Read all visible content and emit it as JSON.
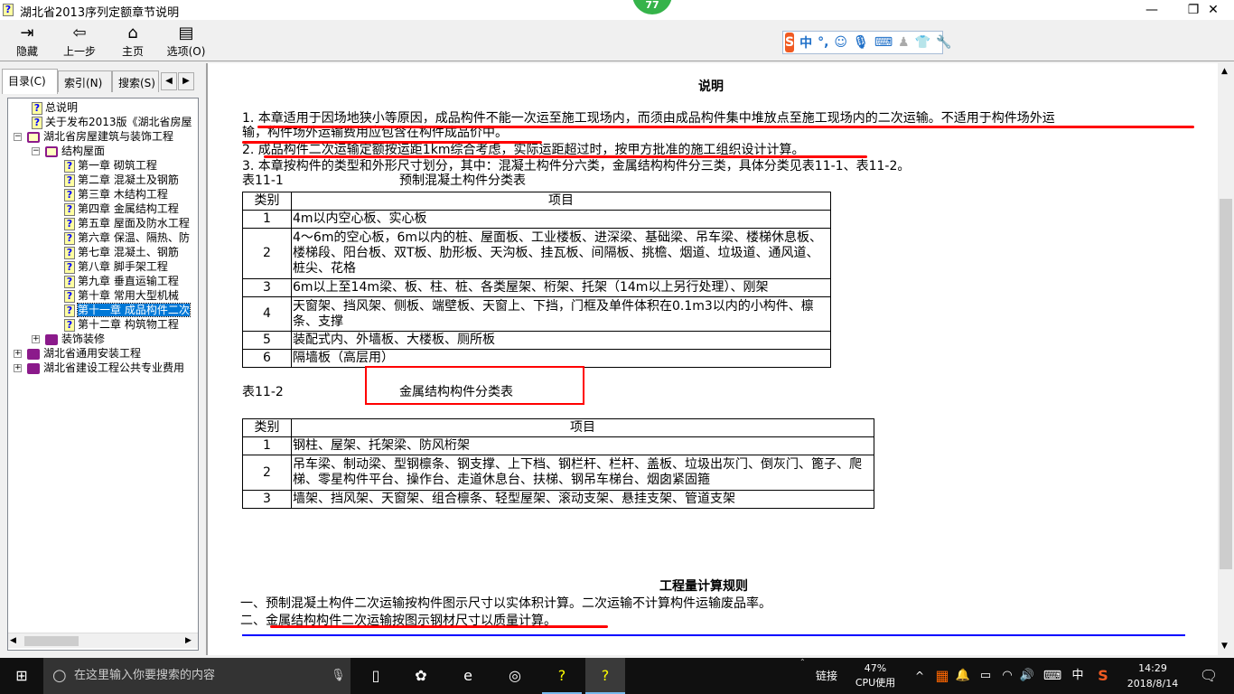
{
  "window": {
    "title": "湖北省2013序列定额章节说明",
    "badge": "77"
  },
  "toolbar": {
    "hide": "隐藏",
    "back": "上一步",
    "home": "主页",
    "options": "选项(O)"
  },
  "ime": {
    "lang": "中",
    "punct": "°,"
  },
  "tabs": {
    "contents": "目录(C)",
    "index": "索引(N)",
    "search": "搜索(S)"
  },
  "tree": [
    {
      "label": "总说明",
      "level": 2,
      "icon": "help-page"
    },
    {
      "label": "关于发布2013版《湖北省房屋",
      "level": 2,
      "icon": "help-page"
    },
    {
      "label": "湖北省房屋建筑与装饰工程",
      "level": 1,
      "icon": "open-book",
      "toggle": "−"
    },
    {
      "label": "结构屋面",
      "level": 2,
      "icon": "open-book",
      "toggle": "−"
    },
    {
      "label": "第一章  砌筑工程",
      "level": 3,
      "icon": "help-page"
    },
    {
      "label": "第二章  混凝土及钢筋",
      "level": 3,
      "icon": "help-page"
    },
    {
      "label": "第三章  木结构工程",
      "level": 3,
      "icon": "help-page"
    },
    {
      "label": "第四章  金属结构工程",
      "level": 3,
      "icon": "help-page"
    },
    {
      "label": "第五章  屋面及防水工程",
      "level": 3,
      "icon": "help-page"
    },
    {
      "label": "第六章  保温、隔热、防",
      "level": 3,
      "icon": "help-page"
    },
    {
      "label": "第七章  混凝土、钢筋",
      "level": 3,
      "icon": "help-page"
    },
    {
      "label": "第八章  脚手架工程",
      "level": 3,
      "icon": "help-page"
    },
    {
      "label": "第九章  垂直运输工程",
      "level": 3,
      "icon": "help-page"
    },
    {
      "label": "第十章  常用大型机械",
      "level": 3,
      "icon": "help-page"
    },
    {
      "label": "第十一章  成品构件二次",
      "level": 3,
      "icon": "help-page",
      "selected": true
    },
    {
      "label": "第十二章  构筑物工程",
      "level": 3,
      "icon": "help-page"
    },
    {
      "label": "装饰装修",
      "level": 2,
      "icon": "closed-book",
      "toggle": "+"
    },
    {
      "label": "湖北省通用安装工程",
      "level": 1,
      "icon": "closed-book",
      "toggle": "+"
    },
    {
      "label": "湖北省建设工程公共专业费用",
      "level": 1,
      "icon": "closed-book",
      "toggle": "+"
    }
  ],
  "doc": {
    "title": "说明",
    "p1a": "1. 本章适用于因场地狭小等原因，成品构件不能一次运至施工现场内，而须由成品构件集中堆放点至施工现场内的二次运输。不适用于构件场外运",
    "p1b": "输，构件场外运输费用应包含在构件成品价中。",
    "p2": "2. 成品构件二次运输定额按运距1km综合考虑，实际运距超过时，按甲方批准的施工组织设计计算。",
    "p3": "3. 本章按构件的类型和外形尺寸划分，其中：混凝土构件分六类，金属结构构件分三类，具体分类见表11-1、表11-2。",
    "t1_label": "表11-1",
    "t1_title": "预制混凝土构件分类表",
    "t2_label": "表11-2",
    "t2_title": "金属结构构件分类表",
    "col_cat": "类别",
    "col_item": "项目",
    "table1": [
      {
        "cat": "1",
        "item": "4m以内空心板、实心板"
      },
      {
        "cat": "2",
        "item": "4～6m的空心板，6m以内的桩、屋面板、工业楼板、进深梁、基础梁、吊车梁、楼梯休息板、楼梯段、阳台板、双T板、肋形板、天沟板、挂瓦板、间隔板、挑檐、烟道、垃圾道、通风道、桩尖、花格"
      },
      {
        "cat": "3",
        "item": "6m以上至14m梁、板、柱、桩、各类屋架、桁架、托架（14m以上另行处理）、刚架"
      },
      {
        "cat": "4",
        "item": "天窗架、挡风架、侧板、端壁板、天窗上、下挡，门框及单件体积在0.1m3以内的小构件、檩条、支撑"
      },
      {
        "cat": "5",
        "item": "装配式内、外墙板、大楼板、厕所板"
      },
      {
        "cat": "6",
        "item": "隔墙板（高层用）"
      }
    ],
    "table2": [
      {
        "cat": "1",
        "item": "钢柱、屋架、托架梁、防风桁架"
      },
      {
        "cat": "2",
        "item": "吊车梁、制动梁、型钢檩条、钢支撑、上下档、钢栏杆、栏杆、盖板、垃圾出灰门、倒灰门、篦子、爬梯、零星构件平台、操作台、走道休息台、扶梯、钢吊车梯台、烟囱紧固箍"
      },
      {
        "cat": "3",
        "item": "墙架、挡风架、天窗架、组合檩条、轻型屋架、滚动支架、悬挂支架、管道支架"
      }
    ],
    "rules_title": "工程量计算规则",
    "r1": "一、预制混凝土构件二次运输按构件图示尺寸以实体积计算。二次运输不计算构件运输废品率。",
    "r2": "二、金属结构构件二次运输按图示钢材尺寸以质量计算。"
  },
  "taskbar": {
    "search_placeholder": "在这里输入你要搜索的内容",
    "link": "链接",
    "cpu_pct": "47%",
    "cpu_label": "CPU使用",
    "ime": "中",
    "time": "14:29",
    "date": "2018/8/14"
  }
}
